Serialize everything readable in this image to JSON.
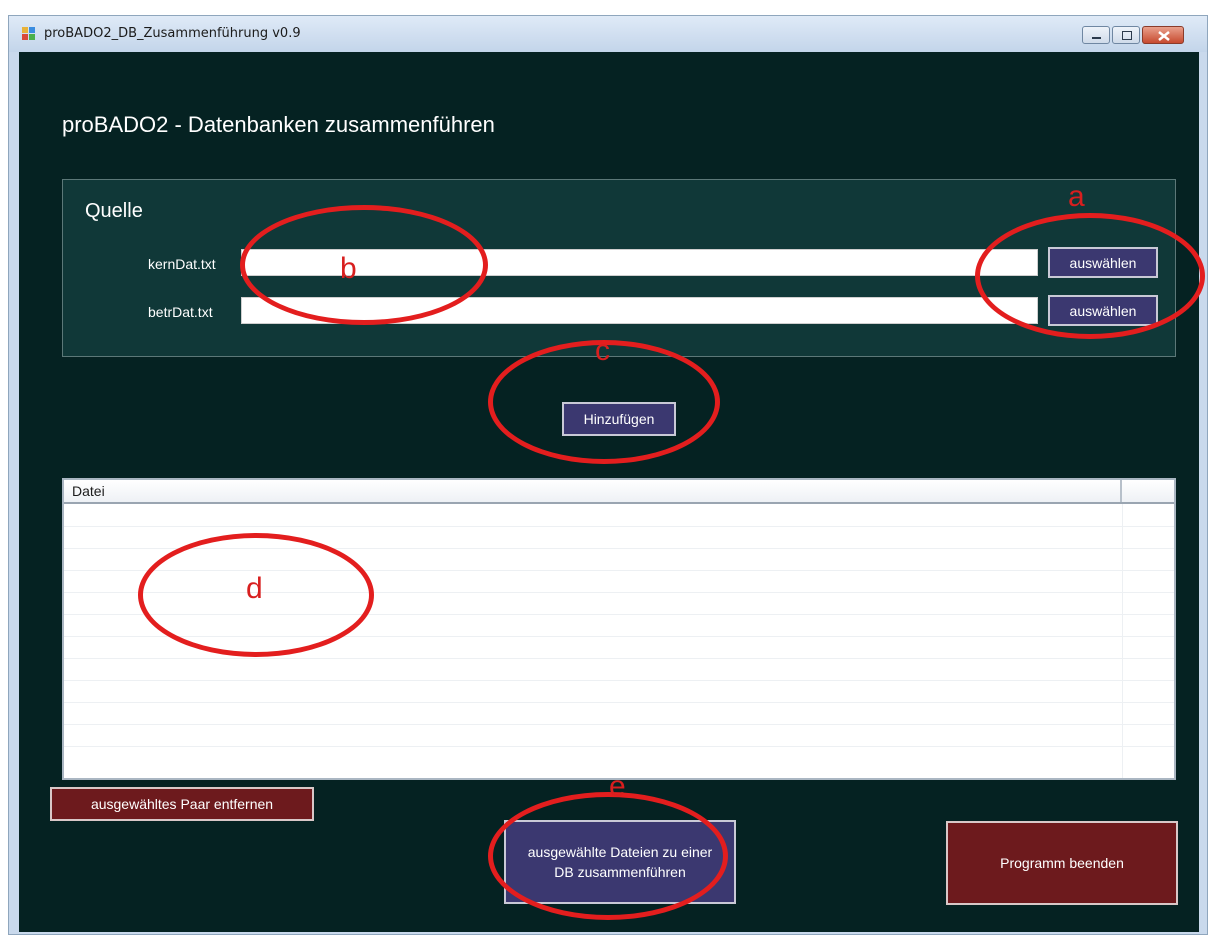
{
  "window": {
    "title": "proBADO2_DB_Zusammenführung v0.9"
  },
  "main": {
    "heading": "proBADO2 - Datenbanken zusammenführen"
  },
  "source": {
    "title": "Quelle",
    "fields": [
      {
        "label": "kernDat.txt",
        "value": "",
        "button": "auswählen"
      },
      {
        "label": "betrDat.txt",
        "value": "",
        "button": "auswählen"
      }
    ],
    "add_button": "Hinzufügen"
  },
  "list": {
    "columns": [
      "Datei",
      ""
    ],
    "rows": []
  },
  "actions": {
    "remove_pair": "ausgewähltes Paar entfernen",
    "merge": "ausgewählte Dateien zu einer DB zusammenführen",
    "exit": "Programm beenden"
  },
  "annotations": [
    "a",
    "b",
    "c",
    "d",
    "e"
  ],
  "colors": {
    "background": "#052222",
    "group_background": "#103838",
    "button_blue": "#3b3870",
    "button_maroon": "#6d1a1d",
    "annotation_red": "#e31e1e"
  }
}
